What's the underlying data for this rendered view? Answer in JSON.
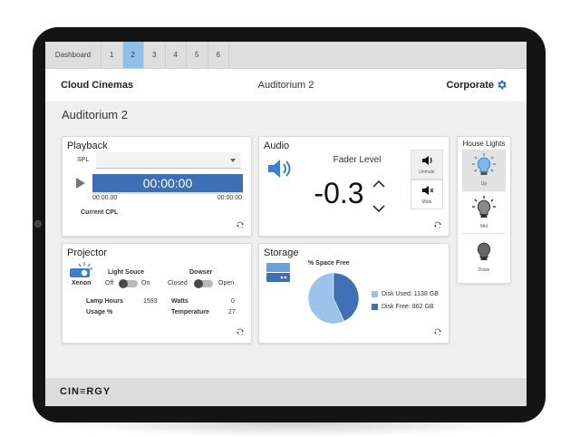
{
  "tabs": [
    {
      "label": "Dashboard"
    },
    {
      "label": "1"
    },
    {
      "label": "2",
      "active": true
    },
    {
      "label": "3"
    },
    {
      "label": "4"
    },
    {
      "label": "5"
    },
    {
      "label": "6"
    }
  ],
  "header": {
    "brand": "Cloud Cinemas",
    "title": "Auditorium 2",
    "account": "Corporate",
    "settings_icon": "gear-icon"
  },
  "page_title": "Auditorium 2",
  "playback": {
    "title": "Playback",
    "spl_label": "SPL",
    "spl_value": "",
    "timecode": "00:00:00",
    "time_left": "00:00.00",
    "time_right": "00:00.00",
    "cpl_label": "Current CPL",
    "progress": 0
  },
  "audio": {
    "title": "Audio",
    "fader_label": "Fader Level",
    "fader_value": "-0.3",
    "unmute_label": "Unmute",
    "mute_label": "Mute"
  },
  "house_lights": {
    "title": "House Lights",
    "buttons": [
      {
        "label": "Up",
        "active": true
      },
      {
        "label": "Mid"
      },
      {
        "label": "Down"
      }
    ]
  },
  "projector": {
    "title": "Projector",
    "lamp_type": "Xenon",
    "light_source_label": "Light Souce",
    "light_off": "Off",
    "light_on": "On",
    "dowser_label": "Dowser",
    "dowser_closed": "Closed",
    "dowser_open": "Open",
    "lamp_hours_label": "Lamp Hours",
    "lamp_hours": "1593",
    "usage_label": "Usage %",
    "usage": "",
    "watts_label": "Watts",
    "watts": "0",
    "temperature_label": "Temperature",
    "temperature": "27"
  },
  "storage": {
    "title": "Storage",
    "chart_title": "% Space Free",
    "used_label": "Disk Used: 1138 GB",
    "free_label": "Disk Free: 862 GB"
  },
  "chart_data": {
    "type": "pie",
    "title": "% Space Free",
    "categories": [
      "Disk Used",
      "Disk Free"
    ],
    "values": [
      1138,
      862
    ],
    "units": "GB",
    "colors": [
      "#9cc3ea",
      "#3f6fb5"
    ],
    "legend": "right"
  },
  "footer": {
    "logo": "CIN≡RGY"
  },
  "colors": {
    "accent": "#2d6bb8",
    "tab_active": "#8fc0e8",
    "timecode_bg": "#3c6fb5"
  }
}
